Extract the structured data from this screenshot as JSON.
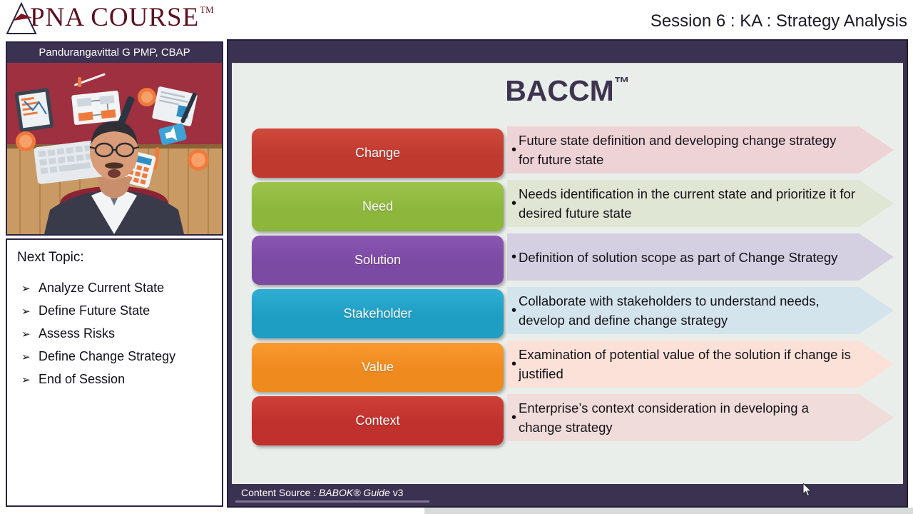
{
  "header": {
    "brand_word": "PNA COURSE",
    "brand_tm": "TM",
    "logo_icon": "triangle-a-logo-icon",
    "session_title": "Session 6 : KA : Strategy Analysis"
  },
  "presenter": {
    "name": "Pandurangavittal G PMP, CBAP",
    "video_label": "presenter-webcam-video"
  },
  "next_topic": {
    "heading": "Next Topic:",
    "bullet_glyph": "➢",
    "items": [
      "Analyze Current State",
      "Define Future State",
      "Assess Risks",
      "Define Change Strategy",
      "End of Session"
    ]
  },
  "slide": {
    "title": "BACCM",
    "title_tm": "™",
    "bullet_glyph": "•",
    "rows": [
      {
        "label": "Change",
        "description": "Future state definition and developing change strategy for future state",
        "chip_color": "#c0392f",
        "chip_gradient_light": "#cf4a3c",
        "arrow_color": "#eed3d6"
      },
      {
        "label": "Need",
        "description": "Needs identification in the current state and prioritize it for desired future state",
        "chip_color": "#8cb63c",
        "chip_gradient_light": "#9cc44c",
        "arrow_color": "#dfe6d4"
      },
      {
        "label": "Solution",
        "description": "Definition of solution scope as part of Change Strategy",
        "chip_color": "#7b4aa3",
        "chip_gradient_light": "#8a56b3",
        "arrow_color": "#d5cfe2"
      },
      {
        "label": "Stakeholder",
        "description": "Collaborate with stakeholders to understand needs, develop and define change strategy",
        "chip_color": "#1f9ec4",
        "chip_gradient_light": "#2fadd3",
        "arrow_color": "#d4e4ed"
      },
      {
        "label": "Value",
        "description": "Examination of potential value of the solution if change is justified",
        "chip_color": "#ef8a1f",
        "chip_gradient_light": "#f99a2f",
        "arrow_color": "#fbe1d8"
      },
      {
        "label": "Context",
        "description": "Enterprise’s context consideration in developing a change strategy",
        "chip_color": "#c0302c",
        "chip_gradient_light": "#cf403a",
        "arrow_color": "#f0dcda"
      }
    ],
    "footer": {
      "prefix": "Content Source : ",
      "source_italic": "BABOK® Guide",
      "version": " v3"
    }
  },
  "colors": {
    "banner_purple": "#3b3151",
    "slide_bg": "#eaeeea",
    "brand_maroon": "#5d1020",
    "title_ink": "#3d3450"
  }
}
